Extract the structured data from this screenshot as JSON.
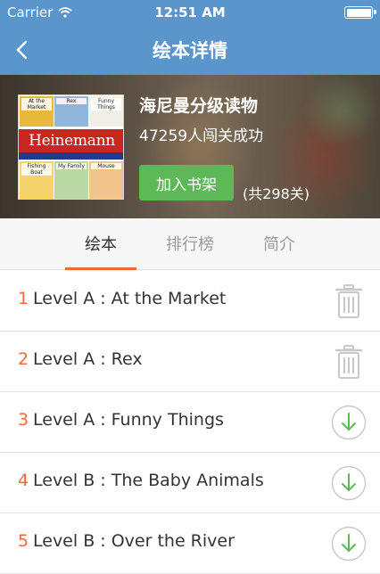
{
  "status_bar": {
    "carrier": "Carrier",
    "time": "12:51 AM"
  },
  "nav": {
    "title": "绘本详情",
    "back_icon": "chevron-left-icon"
  },
  "book": {
    "title": "海尼曼分级读物",
    "stat": "47259人闯关成功",
    "add_button": "加入书架",
    "level_count": "(共298关)",
    "cover": {
      "brand": "Heinemann",
      "tiles": [
        "At the Market",
        "Rex",
        "Funny Things",
        "Fishing Boat",
        "My Family",
        "Mouse"
      ]
    }
  },
  "tabs": [
    {
      "label": "绘本",
      "active": true
    },
    {
      "label": "排行榜",
      "active": false
    },
    {
      "label": "简介",
      "active": false
    }
  ],
  "items": [
    {
      "num": "1",
      "name": "Level A : At the Market",
      "action": "trash-icon"
    },
    {
      "num": "2",
      "name": "Level A : Rex",
      "action": "trash-icon"
    },
    {
      "num": "3",
      "name": "Level A : Funny Things",
      "action": "download-icon"
    },
    {
      "num": "4",
      "name": "Level B : The Baby Animals",
      "action": "download-icon"
    },
    {
      "num": "5",
      "name": "Level B : Over the River",
      "action": "download-icon"
    }
  ],
  "colors": {
    "nav": "#5a95cc",
    "accent": "#f06a35",
    "button": "#5fb857",
    "download": "#5fb857",
    "trash": "#c8c8c8"
  }
}
